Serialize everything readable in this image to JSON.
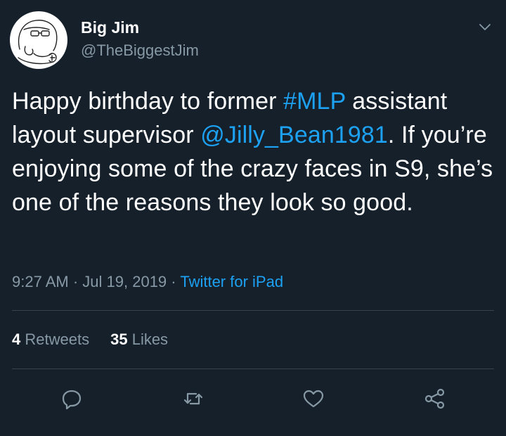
{
  "author": {
    "name": "Big Jim",
    "handle": "@TheBiggestJim",
    "avatar": "cartoon-sketch-avatar"
  },
  "tweet": {
    "segments": [
      {
        "text": "Happy birthday to former ",
        "type": "text"
      },
      {
        "text": "#MLP",
        "type": "hashtag"
      },
      {
        "text": " assistant layout supervisor ",
        "type": "text"
      },
      {
        "text": "@Jilly_Bean1981",
        "type": "mention"
      },
      {
        "text": ". If you’re enjoying some of the crazy faces in S9, she’s one of the reasons they look so good.",
        "type": "text"
      }
    ],
    "time": "9:27 AM",
    "separator": "·",
    "date": "Jul 19, 2019",
    "source": "Twitter for iPad"
  },
  "stats": {
    "retweets_count": "4",
    "retweets_label": "Retweets",
    "likes_count": "35",
    "likes_label": "Likes"
  },
  "actions": [
    "reply-icon",
    "retweet-icon",
    "like-icon",
    "share-icon"
  ],
  "colors": {
    "background": "#15202b",
    "text": "#ffffff",
    "secondary": "#8899a6",
    "accent": "#1da1f2",
    "divider": "#38444d"
  }
}
